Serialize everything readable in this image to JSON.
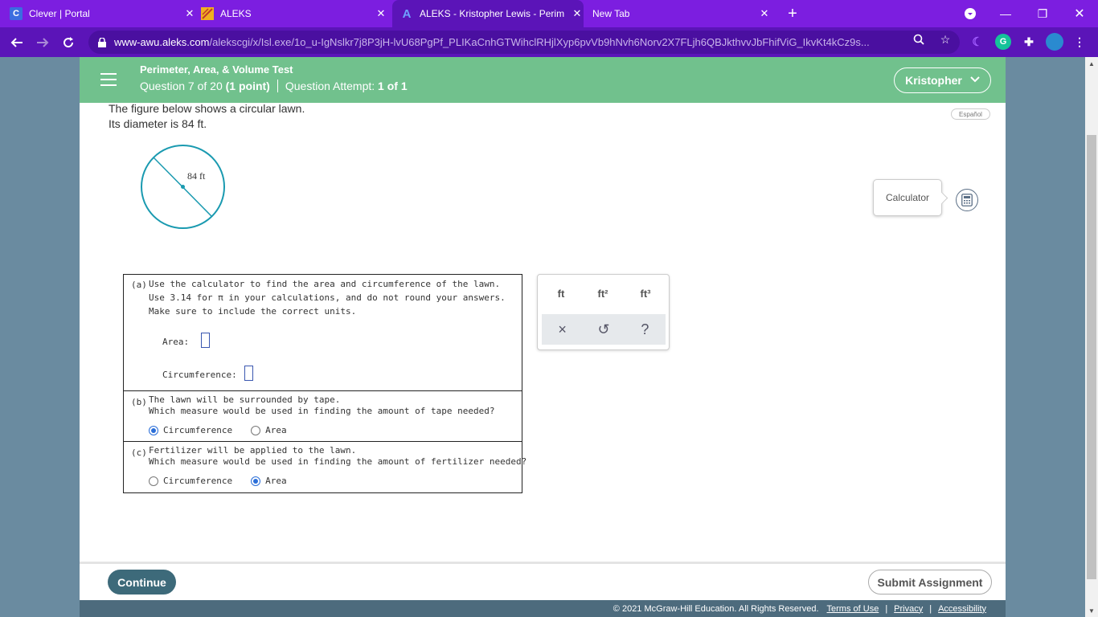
{
  "browser": {
    "tabs": [
      {
        "title": "Clever | Portal",
        "favicon": "C",
        "favicon_color": "#3b6de0"
      },
      {
        "title": "ALEKS",
        "favicon": "",
        "favicon_color": "#f0b020"
      },
      {
        "title": "ALEKS - Kristopher Lewis - Perim",
        "favicon": "A",
        "favicon_color": "#3b56a8"
      },
      {
        "title": "New Tab",
        "favicon": "",
        "favicon_color": ""
      }
    ],
    "url_host": "www-awu.aleks.com",
    "url_path": "/alekscgi/x/Isl.exe/1o_u-IgNslkr7j8P3jH-lvU68PgPf_PLIKaCnhGTWihclRHjlXyp6pvVb9hNvh6Norv2X7FLjh6QBJkthvvJbFhifViG_IkvKt4kCz9s...",
    "theme_color": "#7c1ee0"
  },
  "header": {
    "test_title": "Perimeter, Area, & Volume Test",
    "question_label": "Question 7 of 20",
    "points": "(1 point)",
    "attempt_label": "Question Attempt:",
    "attempt_value": "1 of 1",
    "user_name": "Kristopher",
    "color": "#71c18d"
  },
  "prompt": {
    "line1": "The figure below shows a circular lawn.",
    "line2": "Its diameter is 84 ft."
  },
  "espanol_label": "Español",
  "figure": {
    "diameter_label": "84 ft"
  },
  "calculator": {
    "label": "Calculator"
  },
  "part_a": {
    "label": "(a)",
    "line1": "Use the calculator to find the area and circumference of the lawn.",
    "line2": "Use 3.14 for π in your calculations, and do not round your answers.",
    "line3": "Make sure to include the correct units.",
    "area_label": "Area:",
    "circumference_label": "Circumference:"
  },
  "part_b": {
    "label": "(b)",
    "line1": "The lawn will be surrounded by tape.",
    "line2": "Which measure would be used in finding the amount of tape needed?",
    "options": [
      "Circumference",
      "Area"
    ],
    "selected": "Circumference"
  },
  "part_c": {
    "label": "(c)",
    "line1": "Fertilizer will be applied to the lawn.",
    "line2": "Which measure would be used in finding the amount of fertilizer needed?",
    "options": [
      "Circumference",
      "Area"
    ],
    "selected": "Area"
  },
  "unit_pad": {
    "units": [
      "ft",
      "ft²",
      "ft³"
    ],
    "tools": [
      "×",
      "↺",
      "?"
    ]
  },
  "footer": {
    "continue_label": "Continue",
    "submit_label": "Submit Assignment",
    "copyright": "© 2021 McGraw-Hill Education. All Rights Reserved.",
    "links": [
      "Terms of Use",
      "Privacy",
      "Accessibility"
    ]
  }
}
